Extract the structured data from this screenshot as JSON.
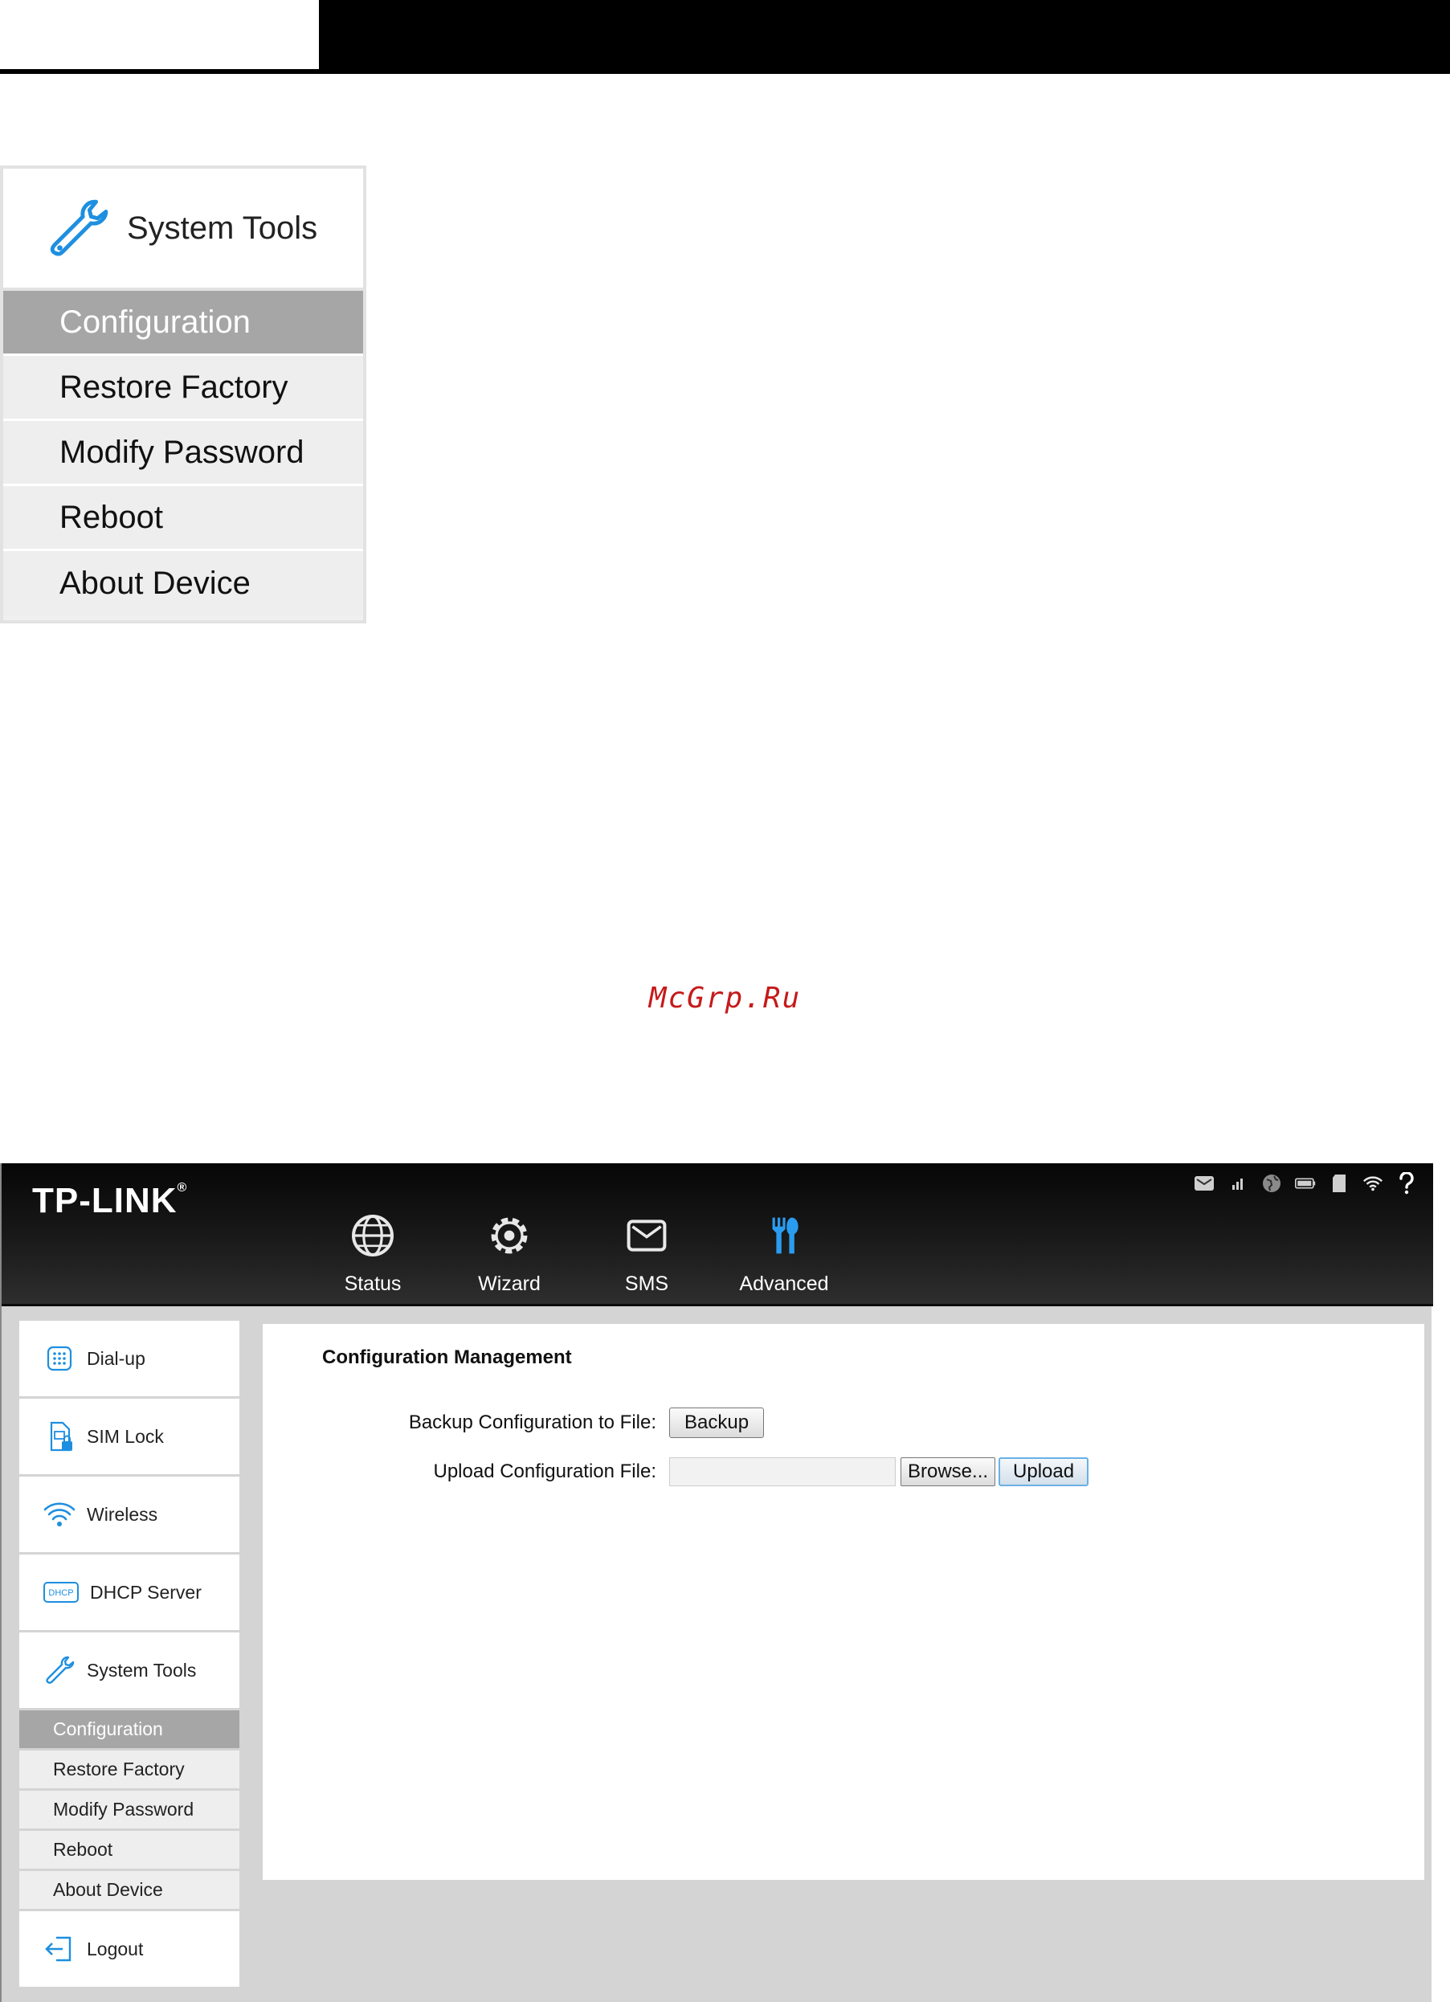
{
  "zoom_menu": {
    "header_label": "System Tools",
    "items": [
      "Configuration",
      "Restore Factory",
      "Modify Password",
      "Reboot",
      "About Device"
    ]
  },
  "watermark": "McGrp.Ru",
  "router": {
    "logo": "TP-LINK",
    "logo_mark": "®",
    "nav": [
      {
        "label": "Status",
        "icon": "globe-icon"
      },
      {
        "label": "Wizard",
        "icon": "gear-icon"
      },
      {
        "label": "SMS",
        "icon": "envelope-icon"
      },
      {
        "label": "Advanced",
        "icon": "tools-icon"
      }
    ],
    "status_icons": [
      "mail-icon",
      "signal-icon",
      "internet-icon",
      "battery-icon",
      "sd-card-icon",
      "wifi-icon",
      "help-icon"
    ],
    "sidebar": {
      "items": [
        {
          "label": "Dial-up",
          "icon": "dialpad-icon"
        },
        {
          "label": "SIM Lock",
          "icon": "sim-lock-icon"
        },
        {
          "label": "Wireless",
          "icon": "wifi-icon"
        },
        {
          "label": "DHCP Server",
          "icon": "dhcp-icon"
        },
        {
          "label": "System Tools",
          "icon": "wrench-icon"
        }
      ],
      "subitems": [
        "Configuration",
        "Restore Factory",
        "Modify Password",
        "Reboot",
        "About Device"
      ],
      "logout": {
        "label": "Logout",
        "icon": "logout-icon"
      }
    },
    "content": {
      "title": "Configuration Management",
      "backup_label": "Backup Configuration to File:",
      "backup_button": "Backup",
      "upload_label": "Upload Configuration File:",
      "browse_button": "Browse...",
      "upload_button": "Upload",
      "dhcp_badge": "DHCP"
    },
    "colors": {
      "accent": "#1e8fe0",
      "active_menu": "#a6a6a6"
    }
  }
}
